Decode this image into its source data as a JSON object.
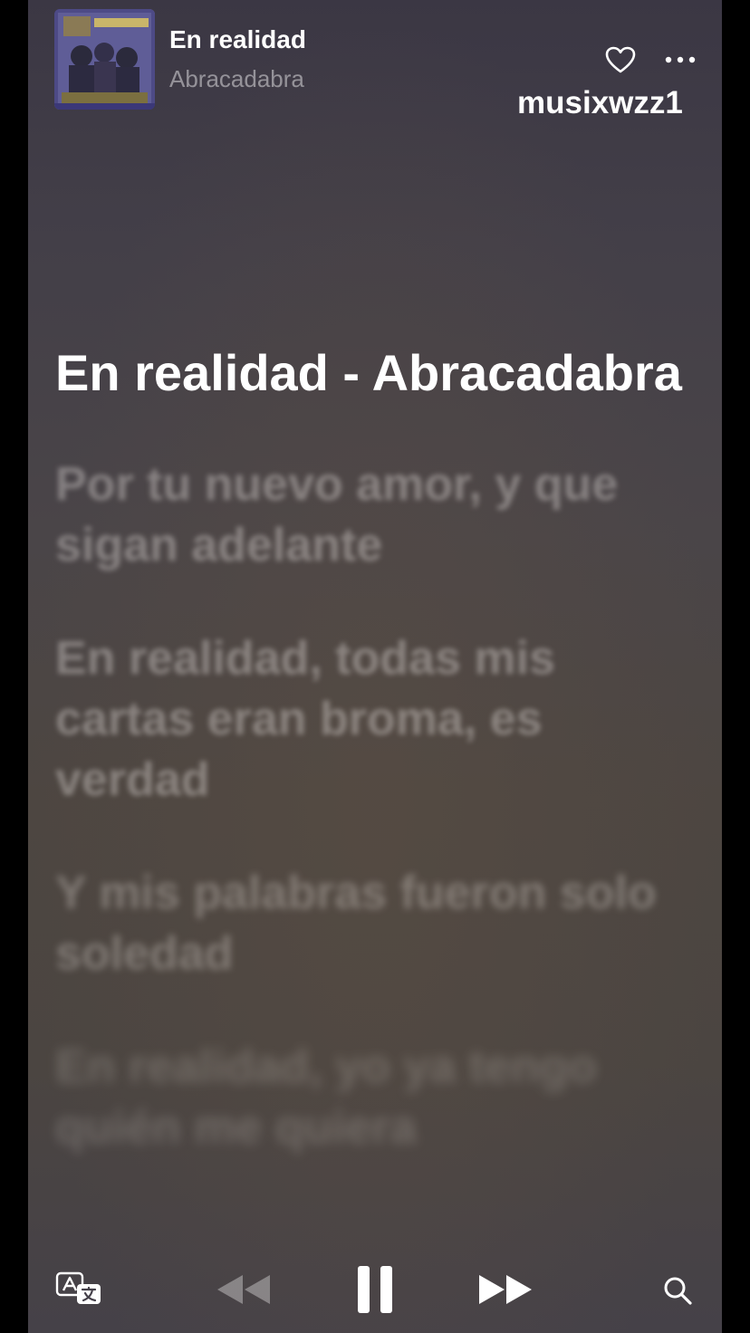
{
  "now_playing": {
    "title": "En realidad",
    "artist": "Abracadabra"
  },
  "watermark": "musixwzz1",
  "lyrics": {
    "heading": "En realidad - Abracadabra",
    "lines": [
      "Por tu nuevo amor, y que sigan adelante",
      "En realidad, todas mis cartas eran broma, es verdad",
      "Y mis palabras fueron solo soledad",
      "En realidad, yo ya tengo quién me quiera"
    ]
  },
  "icons": {
    "favorite": "heart-outline-icon",
    "more": "ellipsis-icon",
    "translate": "translate-icon",
    "rewind": "rewind-icon",
    "pause": "pause-icon",
    "forward": "fast-forward-icon",
    "search": "search-icon"
  },
  "colors": {
    "background_top": "#3b3744",
    "background_bottom": "#454148",
    "text_primary": "#ffffff",
    "text_secondary": "rgba(255,255,255,0.45)"
  }
}
